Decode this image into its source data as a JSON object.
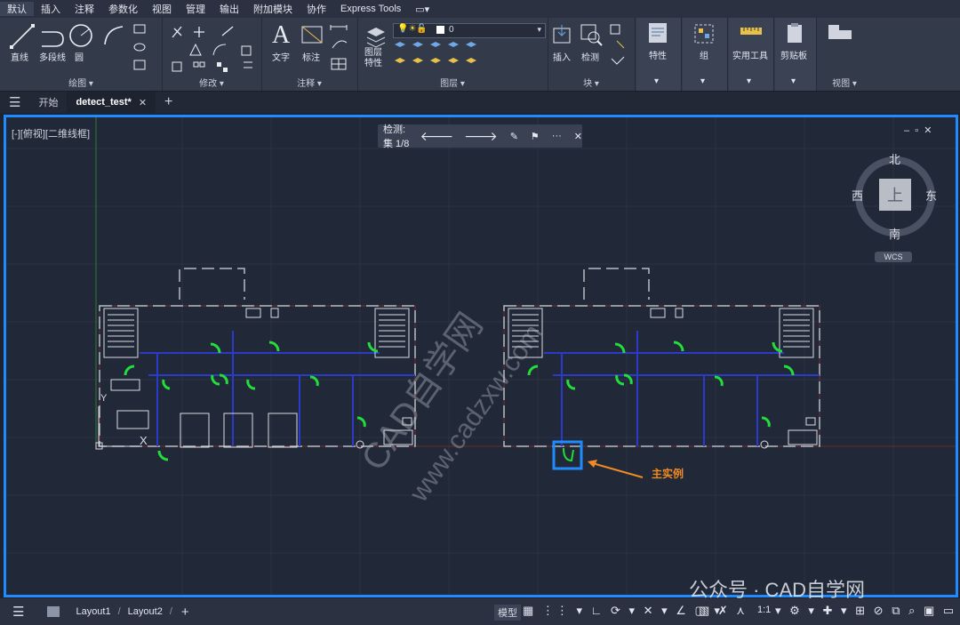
{
  "menubar": {
    "items": [
      "默认",
      "插入",
      "注释",
      "参数化",
      "视图",
      "管理",
      "输出",
      "附加模块",
      "协作",
      "Express Tools",
      "▭▾"
    ]
  },
  "ribbon": {
    "draw": {
      "title": "绘图 ▾",
      "line": "直线",
      "polyline": "多段线",
      "circle": "圆"
    },
    "modify": {
      "title": "修改 ▾"
    },
    "annotate": {
      "title": "注释 ▾",
      "text": "文字",
      "dimension": "标注"
    },
    "layers": {
      "title": "图层 ▾",
      "props": "图层\n特性",
      "current_layer": "0"
    },
    "block": {
      "title": "块 ▾",
      "insert": "插入",
      "detect": "检测"
    },
    "properties": {
      "label": "特性"
    },
    "groups": {
      "label": "组"
    },
    "utilities": {
      "label": "实用工具"
    },
    "clipboard": {
      "label": "剪贴板"
    },
    "view": {
      "title": "视图 ▾"
    }
  },
  "doc_tabs": {
    "start": "开始",
    "active": "detect_test*",
    "close": "✕",
    "add": "+"
  },
  "viewport": {
    "label": "[-][俯视][二维线框]",
    "detect_toolbar": {
      "label": "检测: 集 1/8",
      "more": "···",
      "close": "✕"
    },
    "viewcube": {
      "north": "北",
      "south": "南",
      "west": "西",
      "east": "东",
      "top": "上",
      "wcs": "WCS"
    },
    "callout": "主实例",
    "watermark": "CAD自学网",
    "watermark2": "www.cadzxw.com",
    "ucs_y": "Y",
    "ucs_x": "X"
  },
  "statusbar": {
    "layout1": "Layout1",
    "layout2": "Layout2",
    "add": "+",
    "model": "模型",
    "scale": "1:1"
  },
  "footer_watermark": "公众号 · CAD自学网"
}
